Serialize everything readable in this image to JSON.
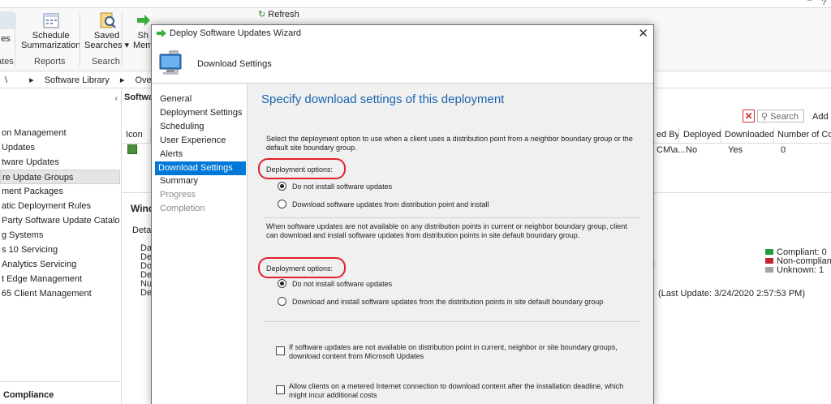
{
  "console": {
    "ribbon": {
      "items": [
        {
          "label1": "es",
          "label2": ""
        },
        {
          "label1": "Schedule",
          "label2": "Summarization"
        },
        {
          "label1": "Saved",
          "label2": "Searches ▾"
        },
        {
          "label1": "Sh",
          "label2": "Mem"
        }
      ],
      "refresh_label": "Refresh",
      "sections": [
        "ates",
        "Reports",
        "Search"
      ]
    },
    "address": {
      "parts": [
        "\\",
        "▸",
        "Software Library",
        "▸",
        "Overview",
        "▸"
      ]
    },
    "nav": {
      "collapse": "‹",
      "items": [
        {
          "label": "on Management",
          "selected": false
        },
        {
          "label": " Updates",
          "selected": false
        },
        {
          "label": "tware Updates",
          "selected": false
        },
        {
          "label": "re Update Groups",
          "selected": true
        },
        {
          "label": "ment Packages",
          "selected": false
        },
        {
          "label": "atic Deployment Rules",
          "selected": false
        },
        {
          "label": "Party Software Update Catalogs",
          "selected": false
        },
        {
          "label": "g Systems",
          "selected": false
        },
        {
          "label": "s 10 Servicing",
          "selected": false
        },
        {
          "label": " Analytics Servicing",
          "selected": false
        },
        {
          "label": "t Edge Management",
          "selected": false
        },
        {
          "label": "65 Client Management",
          "selected": false
        }
      ],
      "footer": " Compliance"
    },
    "content": {
      "title": "Softwa",
      "search_placeholder": "Search",
      "add_criteria": "Add C",
      "columns": [
        "Icon",
        "ed By",
        "Deployed",
        "Downloaded",
        "Number of Colle"
      ],
      "row": {
        "by": "CM\\a...",
        "deployed": "No",
        "downloaded": "Yes",
        "number": "0"
      },
      "detail_title": "Wind",
      "detail_sub": "Detai",
      "detail_lines": [
        "Dat",
        "Des",
        "Dov",
        "Dep",
        "Nur",
        "Dep"
      ],
      "legend": [
        {
          "label": "Compliant: 0",
          "color": "#1e9e3a"
        },
        {
          "label": "Non-compliant: 0",
          "color": "#c0262d"
        },
        {
          "label": "Unknown: 1",
          "color": "#a0a4aa"
        }
      ],
      "last_update": "(Last Update: 3/24/2020 2:57:53 PM)"
    }
  },
  "wizard": {
    "title": "Deploy Software Updates Wizard",
    "close": "✕",
    "header": "Download Settings",
    "steps": [
      {
        "label": "General",
        "state": "normal"
      },
      {
        "label": "Deployment Settings",
        "state": "normal"
      },
      {
        "label": "Scheduling",
        "state": "normal"
      },
      {
        "label": "User Experience",
        "state": "normal"
      },
      {
        "label": "Alerts",
        "state": "normal"
      },
      {
        "label": "Download Settings",
        "state": "active"
      },
      {
        "label": "Summary",
        "state": "normal"
      },
      {
        "label": "Progress",
        "state": "disabled"
      },
      {
        "label": "Completion",
        "state": "disabled"
      }
    ],
    "heading": "Specify download settings of this deployment",
    "intro": "Select the deployment option to use when a client uses a distribution point from a neighbor boundary group or the default site boundary group.",
    "group1": {
      "label": "Deployment options:",
      "options": [
        {
          "label": "Do not install software updates",
          "checked": true
        },
        {
          "label": "Download software updates from distribution point and install",
          "checked": false
        }
      ]
    },
    "middle_text": "When software updates are not available on any distribution points in current or neighbor boundary group, client can download and install software updates from distribution points in site default boundary group.",
    "group2": {
      "label": "Deployment options:",
      "options": [
        {
          "label": "Do not install software updates",
          "checked": true
        },
        {
          "label": "Download and install software updates from the distribution points in site default boundary group",
          "checked": false
        }
      ]
    },
    "checkboxes": [
      {
        "label": "If software updates are not available on distribution point in current, neighbor or site boundary groups, download content from Microsoft Updates",
        "checked": false
      },
      {
        "label": "Allow clients on a metered Internet connection to download content after the installation deadline, which might incur additional costs",
        "checked": false
      }
    ]
  }
}
